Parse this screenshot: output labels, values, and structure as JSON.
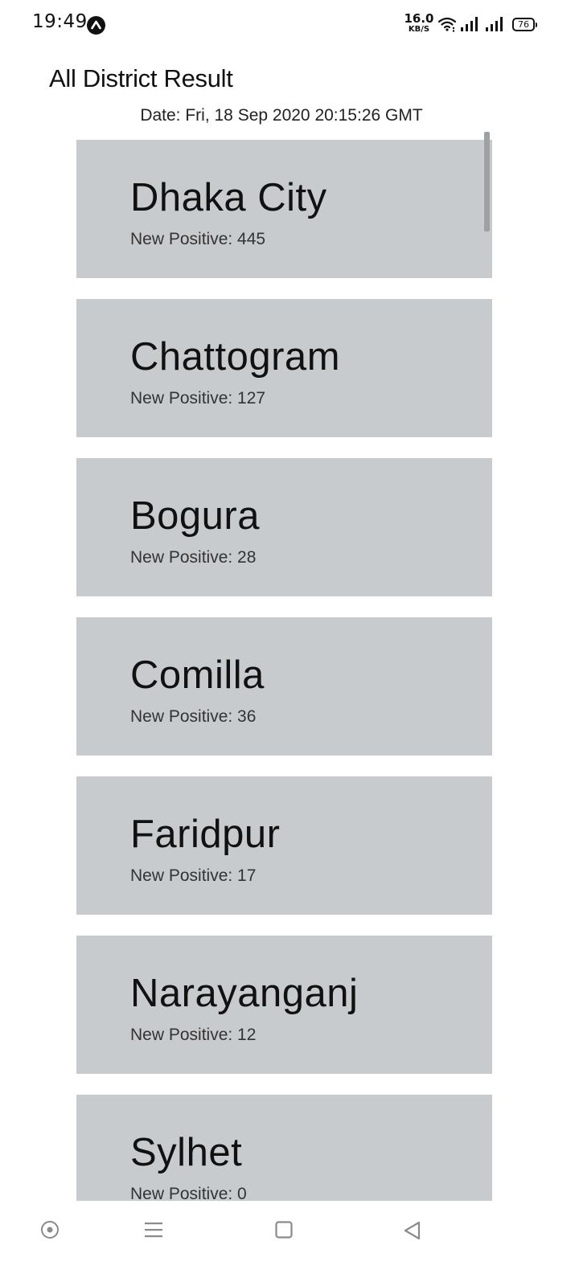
{
  "status_bar": {
    "time": "19:49",
    "net_speed_value": "16.0",
    "net_speed_unit": "KB/S",
    "battery": "76",
    "icons": [
      "app-notification-icon",
      "wifi-icon",
      "signal-icon",
      "signal-icon",
      "battery-icon"
    ]
  },
  "header": {
    "title": "All District Result",
    "date": "Date: Fri, 18 Sep 2020 20:15:26 GMT"
  },
  "districts": [
    {
      "name": "Dhaka City",
      "positive": "New Positive: 445"
    },
    {
      "name": "Chattogram",
      "positive": "New Positive: 127"
    },
    {
      "name": "Bogura",
      "positive": "New Positive: 28"
    },
    {
      "name": "Comilla",
      "positive": "New Positive: 36"
    },
    {
      "name": "Faridpur",
      "positive": "New Positive: 17"
    },
    {
      "name": "Narayanganj",
      "positive": "New Positive: 12"
    },
    {
      "name": "Sylhet",
      "positive": "New Positive: 0"
    }
  ],
  "nav_bar": {
    "icons": [
      "assistant-icon",
      "menu-icon",
      "home-icon",
      "back-icon"
    ]
  },
  "colors": {
    "card_background": "#c8cbce",
    "page_background": "#ffffff",
    "text": "#111111"
  }
}
